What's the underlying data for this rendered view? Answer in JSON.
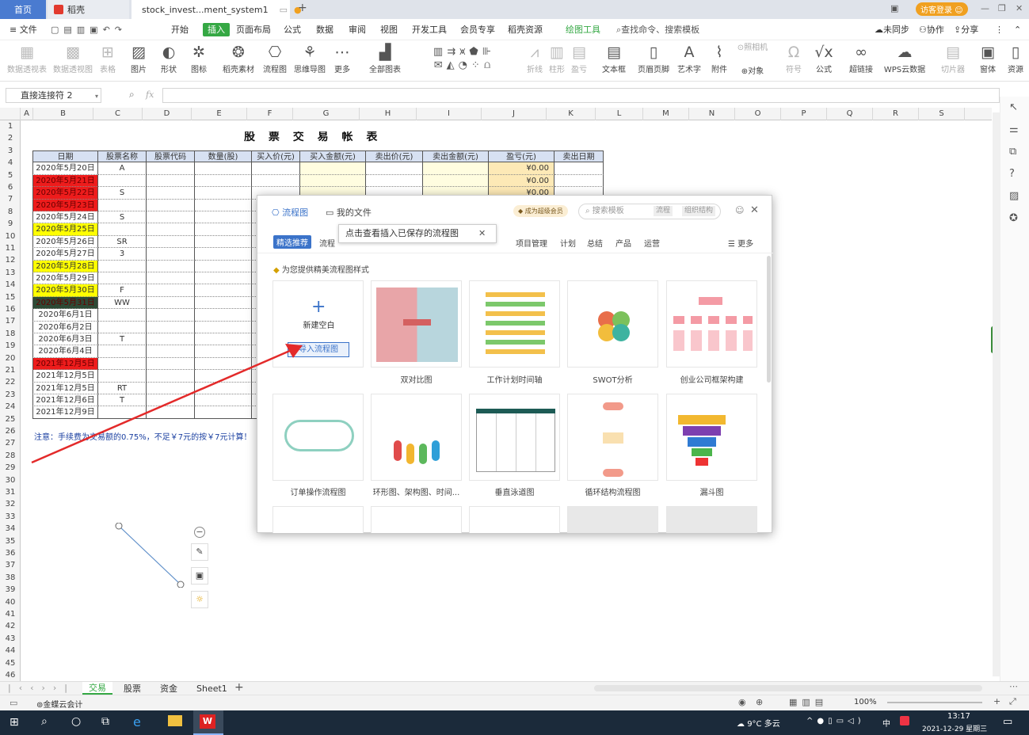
{
  "titlebar": {
    "home_tab": "首页",
    "daoke_tab": "稻壳",
    "doc_tab": "stock_invest...ment_system1",
    "add_tab": "+",
    "login": "访客登录"
  },
  "menubar": {
    "file": "文件",
    "items": [
      "开始",
      "插入",
      "页面布局",
      "公式",
      "数据",
      "审阅",
      "视图",
      "开发工具",
      "会员专享",
      "稻壳资源"
    ],
    "draw_tools": "绘图工具",
    "search": "查找命令、搜索模板",
    "sync": "未同步",
    "collab": "协作",
    "share": "分享"
  },
  "ribbon": {
    "items": [
      "数据透视表",
      "数据透视图",
      "表格",
      "图片",
      "形状",
      "图标",
      "稻壳素材",
      "流程图",
      "思维导图",
      "更多",
      "全部图表",
      "折线",
      "柱形",
      "盈亏",
      "文本框",
      "页眉页脚",
      "艺术字",
      "附件",
      "对象",
      "符号",
      "公式",
      "超链接",
      "WPS云数据",
      "切片器",
      "窗体",
      "资源"
    ],
    "screenshot": "照相机"
  },
  "formula": {
    "name_box": "直接连接符 2",
    "fx_label": "fx"
  },
  "columns": [
    "A",
    "B",
    "C",
    "D",
    "E",
    "F",
    "G",
    "H",
    "I",
    "J",
    "K",
    "L",
    "M",
    "N",
    "O",
    "P",
    "Q",
    "R",
    "S"
  ],
  "rows": [
    "1",
    "2",
    "3",
    "4",
    "5",
    "6",
    "7",
    "8",
    "9",
    "10",
    "11",
    "12",
    "13",
    "14",
    "15",
    "16",
    "17",
    "18",
    "19",
    "20",
    "21",
    "22",
    "23",
    "24",
    "25",
    "26",
    "27",
    "28",
    "29",
    "30",
    "31",
    "32",
    "33",
    "34",
    "35",
    "36",
    "37",
    "38",
    "39",
    "40",
    "41",
    "42",
    "43",
    "44",
    "45",
    "46"
  ],
  "sheet": {
    "title": "股 票 交 易 帐 表",
    "headers": [
      "日期",
      "股票名称",
      "股票代码",
      "数量(股)",
      "买入价(元)",
      "买入金额(元)",
      "卖出价(元)",
      "卖出金额(元)",
      "盈亏(元)",
      "卖出日期"
    ],
    "dates": [
      "2020年5月20日",
      "2020年5月21日",
      "2020年5月22日",
      "2020年5月23日",
      "2020年5月24日",
      "2020年5月25日",
      "2020年5月26日",
      "2020年5月27日",
      "2020年5月28日",
      "2020年5月29日",
      "2020年5月30日",
      "2020年5月31日",
      "2020年6月1日",
      "2020年6月2日",
      "2020年6月3日",
      "2020年6月4日",
      "2021年12月5日",
      "2021年12月5日",
      "2021年12月5日",
      "2021年12月6日",
      "2021年12月9日"
    ],
    "names": [
      "A",
      "",
      "S",
      "",
      "S",
      "",
      "SR",
      "3",
      "",
      "",
      "F",
      "WW",
      "",
      "",
      "T",
      "",
      "",
      "",
      "RT",
      "T",
      ""
    ],
    "profit": [
      "¥0.00",
      "¥0.00",
      "¥0.00"
    ],
    "note": "注意：手续费为交易额的0.75%，不足￥7元的按￥7元计算！"
  },
  "colors": {
    "red": "#ee1c1c",
    "yellow": "#ffff00",
    "dark": "#2d4a35",
    "header_bg": "#d7e1f2",
    "profit_bg": "#fde9b6",
    "buy_bg": "#fffde0",
    "accent": "#35a844",
    "blue": "#4a7bd0"
  },
  "sheet_tabs": [
    "交易",
    "股票",
    "资金",
    "Sheet1"
  ],
  "status": {
    "left": "金蝶云会计",
    "zoom": "100%"
  },
  "taskbar": {
    "weather": "9°C 多云",
    "time": "13:17",
    "date": "2021-12-29 星期三",
    "ime": "中"
  },
  "dialog": {
    "tab_flow": "流程图",
    "tab_files": "我的文件",
    "vip": "成为超级会员",
    "search_placeholder": "搜索模板",
    "search_tag1": "流程",
    "search_tag2": "组织结构",
    "tooltip": "点击查看插入已保存的流程图",
    "cat_selected": "精选推荐",
    "cat_flow": "流程",
    "categories": [
      "项目管理",
      "计划",
      "总结",
      "产品",
      "运营"
    ],
    "more": "更多",
    "subtitle": "为您提供精美流程图样式",
    "new_blank": "新建空白",
    "import": "导入流程图",
    "templates": [
      "双对比图",
      "工作计划时间轴",
      "SWOT分析",
      "创业公司框架构建",
      "订单操作流程图",
      "环形图、架构图、时间...",
      "垂直泳道图",
      "循环结构流程图",
      "漏斗图"
    ]
  },
  "float_tools": [
    "zoom-out",
    "pen",
    "frame",
    "bulb"
  ]
}
